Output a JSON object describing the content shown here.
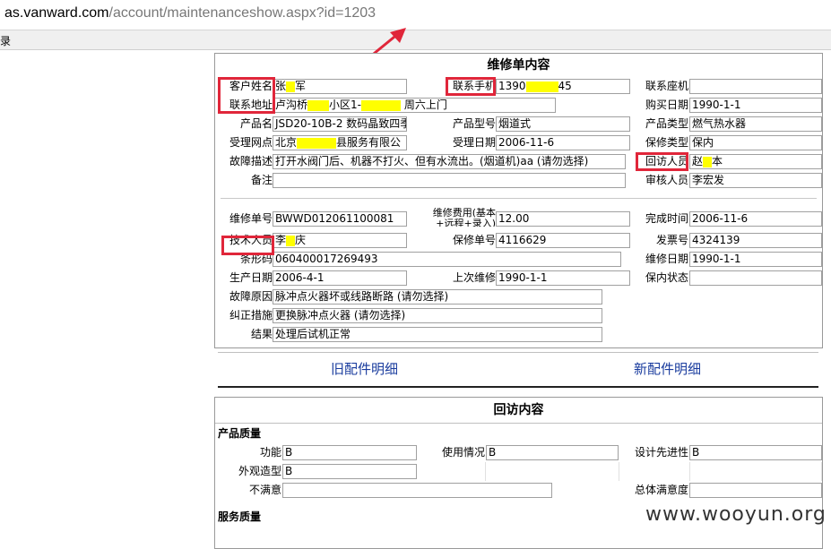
{
  "browser": {
    "url_domain": "as.vanward.com",
    "url_rest": "/account/maintenanceshow.aspx?id=1203",
    "toolbar_label": "录"
  },
  "form1": {
    "title": "维修单内容",
    "fields": {
      "customer_name_label": "客户姓名",
      "customer_name_a": "张",
      "customer_name_b": "军",
      "contact_phone_label": "联系手机",
      "contact_phone_a": "1390",
      "contact_phone_b": "45",
      "landline_label": "联系座机",
      "landline_value": "",
      "address_label": "联系地址",
      "address_a": "卢沟桥",
      "address_b": "小区1-",
      "address_c": "周六上门",
      "purchase_date_label": "购买日期",
      "purchase_date_value": "1990-1-1",
      "product_name_label": "产品名",
      "product_name_value": "JSD20-10B-2 数码晶致四季",
      "product_model_label": "产品型号",
      "product_model_value": "烟道式",
      "product_type_label": "产品类型",
      "product_type_value": "燃气热水器",
      "outlet_label": "受理网点",
      "outlet_a": "北京",
      "outlet_b": "县服务有限公",
      "accept_date_label": "受理日期",
      "accept_date_value": "2006-11-6",
      "warranty_type_label": "保修类型",
      "warranty_type_value": "保内",
      "fault_desc_label": "故障描述",
      "fault_desc_value": "打开水阀门后、机器不打火、但有水流出。(烟道机)aa (请勿选择)",
      "callback_person_label": "回访人员",
      "callback_person_a": "赵",
      "callback_person_b": "本",
      "remark_label": "备注",
      "remark_value": "",
      "auditor_label": "审核人员",
      "auditor_value": "李宏发"
    },
    "repair": {
      "order_no_label": "维修单号",
      "order_no_value": "BWWD012061100081",
      "fee_label_1": "维修费用(基本",
      "fee_label_2": "+远程+录入)",
      "fee_value": "12.00",
      "finish_time_label": "完成时间",
      "finish_time_value": "2006-11-6",
      "technician_label": "技术人员",
      "technician_a": "李",
      "technician_b": "庆",
      "warranty_no_label": "保修单号",
      "warranty_no_value": "4116629",
      "invoice_label": "发票号",
      "invoice_value": "4324139",
      "barcode_label": "条形码",
      "barcode_value": "060400017269493",
      "repair_date_label": "维修日期",
      "repair_date_value": "1990-1-1",
      "prod_date_label": "生产日期",
      "prod_date_value": "2006-4-1",
      "last_repair_label": "上次维修",
      "last_repair_value": "1990-1-1",
      "in_warranty_label": "保内状态",
      "in_warranty_value": "",
      "fault_cause_label": "故障原因",
      "fault_cause_value": "脉冲点火器坏或线路断路 (请勿选择)",
      "correction_label": "纠正措施",
      "correction_value": "更换脉冲点火器 (请勿选择)",
      "result_label": "结果",
      "result_value": "处理后试机正常"
    }
  },
  "links": {
    "old_parts": "旧配件明细",
    "new_parts": "新配件明细"
  },
  "form2": {
    "title": "回访内容",
    "product_quality_head": "产品质量",
    "function_label": "功能",
    "function_value": "B",
    "usage_label": "使用情况",
    "usage_value": "B",
    "design_label": "设计先进性",
    "design_value": "B",
    "appearance_label": "外观造型",
    "appearance_value": "B",
    "dissatisfied_label": "不满意",
    "dissatisfied_value": "",
    "overall_label": "总体满意度",
    "overall_value": "",
    "service_quality_head": "服务质量"
  },
  "watermark": "www.wooyun.org",
  "colors": {
    "highlight": "#ffff00",
    "annotation_red": "#e0263a",
    "link_blue": "#1a3c9e"
  }
}
